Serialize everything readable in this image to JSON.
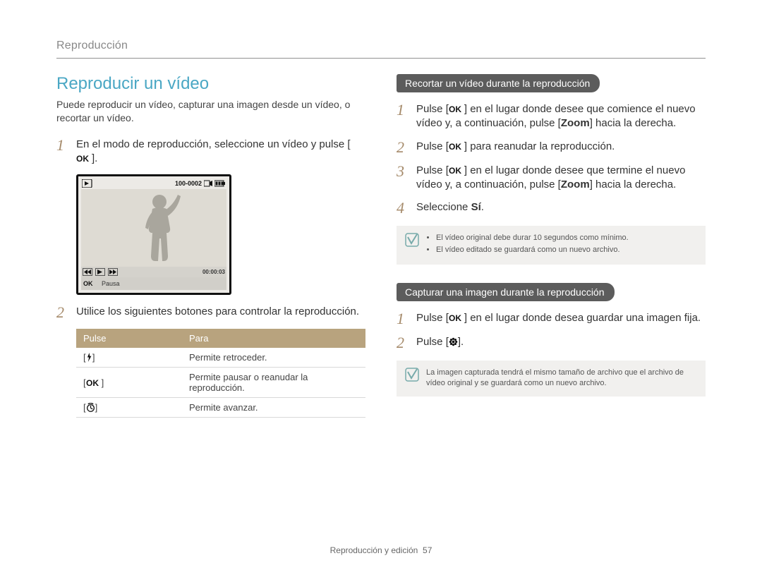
{
  "breadcrumb": "Reproducción",
  "heading": "Reproducir un vídeo",
  "intro": "Puede reproducir un vídeo, capturar una imagen desde un vídeo, o recortar un vídeo.",
  "left_steps": {
    "s1_a": "En el modo de reproducción, seleccione un vídeo y pulse [",
    "s1_b": "].",
    "s2": "Utilice los siguientes botones para controlar la reproducción."
  },
  "preview": {
    "counter": "100-0002",
    "time": "00:00:03",
    "pause_label": "Pausa"
  },
  "table": {
    "h1": "Pulse",
    "h2": "Para",
    "rows": [
      {
        "btn": "flash",
        "desc": "Permite retroceder."
      },
      {
        "btn": "ok",
        "desc": "Permite pausar o reanudar la reproducción."
      },
      {
        "btn": "timer",
        "desc": "Permite avanzar."
      }
    ]
  },
  "trim": {
    "title": "Recortar un vídeo durante la reproducción",
    "s1_a": "Pulse [",
    "s1_b": "] en el lugar donde desee que comience el nuevo vídeo y, a continuación, pulse [",
    "s1_zoom": "Zoom",
    "s1_c": "] hacia la derecha.",
    "s2_a": "Pulse [",
    "s2_b": "] para reanudar la reproducción.",
    "s3_a": "Pulse [",
    "s3_b": "] en el lugar donde desee que termine el nuevo vídeo y, a continuación, pulse [",
    "s3_zoom": "Zoom",
    "s3_c": "] hacia la derecha.",
    "s4_a": "Seleccione ",
    "s4_b": "Sí",
    "s4_c": ".",
    "notes": [
      "El vídeo original debe durar 10 segundos como mínimo.",
      "El vídeo editado se guardará como un nuevo archivo."
    ]
  },
  "capture": {
    "title": "Capturar una imagen durante la reproducción",
    "s1_a": "Pulse [",
    "s1_b": "] en el lugar donde desea guardar una imagen fija.",
    "s2_a": "Pulse [",
    "s2_b": "].",
    "note": "La imagen capturada tendrá el mismo tamaño de archivo que el archivo de vídeo original y se guardará como un nuevo archivo."
  },
  "footer": {
    "section": "Reproducción y edición",
    "page": "57"
  }
}
